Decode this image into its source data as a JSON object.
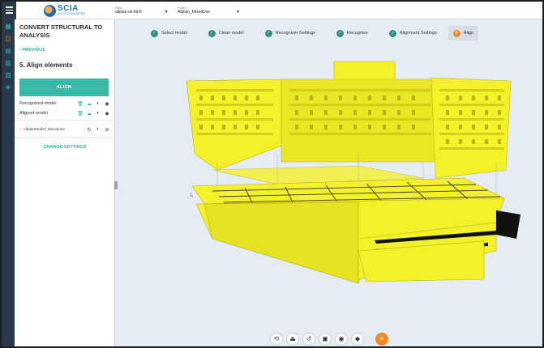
{
  "header": {
    "brand": "SCIA",
    "brand_sub": "AUTOCONVERTER",
    "team_label": "Team",
    "team_value": "allplan-uk-ltd-ft",
    "project_label": "Project",
    "project_value": "Allplan_MixedUse"
  },
  "rail": {
    "icons": [
      "model-icon",
      "structure-icon",
      "analysis-icon",
      "results-icon",
      "report-icon",
      "settings-cube-icon"
    ]
  },
  "panel": {
    "title": "CONVERT STRUCTURAL TO ANALYSIS",
    "previous": "PREVIOUS",
    "step_heading": "5.  Align elements",
    "align_button": "ALIGN",
    "recognized_model": "Recognized model",
    "aligned_model": "Aligned model",
    "source_file": "AllplanModel_MixedUse",
    "change_settings": "CHANGE SETTINGS"
  },
  "steps": [
    {
      "number": "✓",
      "label": "Select model",
      "status": "done"
    },
    {
      "number": "✓",
      "label": "Clean model",
      "status": "done"
    },
    {
      "number": "✓",
      "label": "Recognizer Settings",
      "status": "done"
    },
    {
      "number": "✓",
      "label": "Recognize",
      "status": "done"
    },
    {
      "number": "✓",
      "label": "Alignment Settings",
      "status": "done"
    },
    {
      "number": "6",
      "label": "Align",
      "status": "current"
    }
  ],
  "toolbar": {
    "icons": [
      "navigation-icon",
      "sections-icon",
      "reset-view-icon",
      "screenshot-icon",
      "visibility-icon",
      "layers-icon",
      "filter-icon"
    ]
  },
  "colors": {
    "accent": "#3ab8a8",
    "active_step": "#f08a24",
    "model": "#f4f02a"
  }
}
